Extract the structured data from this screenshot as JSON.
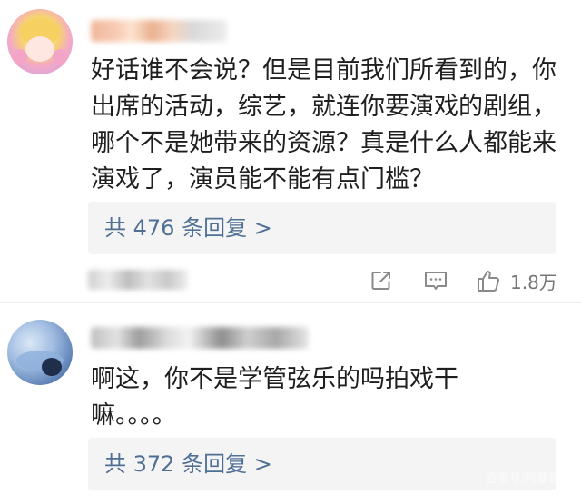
{
  "comments": [
    {
      "avatar_icon": "anime-girl-avatar-icon",
      "text_lines": [
        "好话谁不会说？但是目前我们所看到的，你",
        "出席的活动，综艺，就连你要演戏的剧组，",
        "哪个不是她带来的资源？真是什么人都能来",
        "演戏了，演员能不能有点门槛？"
      ],
      "replies_label": "共 476 条回复 >",
      "like_count": "1.8万",
      "action_icons": [
        "share-icon",
        "comment-icon",
        "thumbs-up-icon"
      ]
    },
    {
      "avatar_icon": "blue-photo-avatar-icon",
      "text_lines": [
        "啊这，你不是学管弦乐的吗拍戏干",
        "嘛。。。。"
      ],
      "replies_label": "共 372 条回复 >"
    }
  ],
  "watermark": "百家号/阿蒙说娱"
}
